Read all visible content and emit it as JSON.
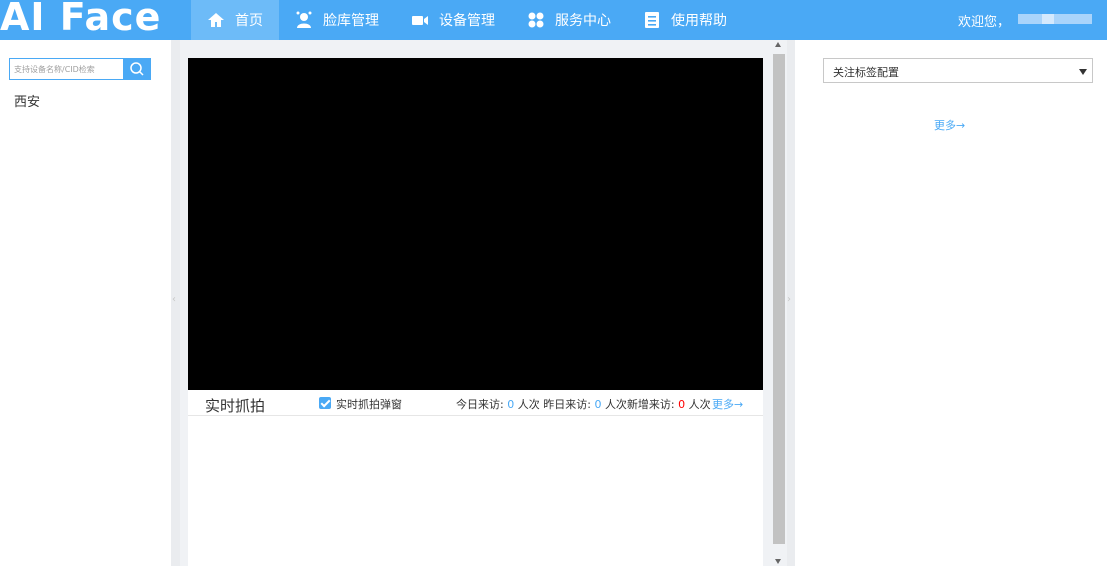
{
  "app": {
    "logo_text": "AI Face"
  },
  "nav": {
    "items": [
      {
        "label": "首页",
        "icon": "home-icon"
      },
      {
        "label": "脸库管理",
        "icon": "user-icon"
      },
      {
        "label": "设备管理",
        "icon": "camera-icon"
      },
      {
        "label": "服务中心",
        "icon": "grid-icon"
      },
      {
        "label": "使用帮助",
        "icon": "document-icon"
      }
    ],
    "active_index": 0,
    "welcome": "欢迎您，"
  },
  "left": {
    "search_placeholder": "支持设备名称/CID检索",
    "tree": [
      "西安"
    ]
  },
  "capture": {
    "title": "实时抓拍",
    "popup_label": "实时抓拍弹窗",
    "popup_checked": true,
    "today_label": "今日来访:",
    "today_count": "0",
    "today_unit": "人次",
    "yesterday_label": "昨日来访:",
    "yesterday_count": "0",
    "yesterday_unit": "人次",
    "new_label": "新增来访:",
    "new_count": "0",
    "new_unit": "人次",
    "more": "更多→"
  },
  "right": {
    "select_value": "关注标签配置",
    "more": "更多→"
  },
  "colors": {
    "nav_bg": "#4aa9f5",
    "nav_active": "#6dbbf8",
    "accent": "#4aa9f5",
    "alert": "#ff0000"
  }
}
